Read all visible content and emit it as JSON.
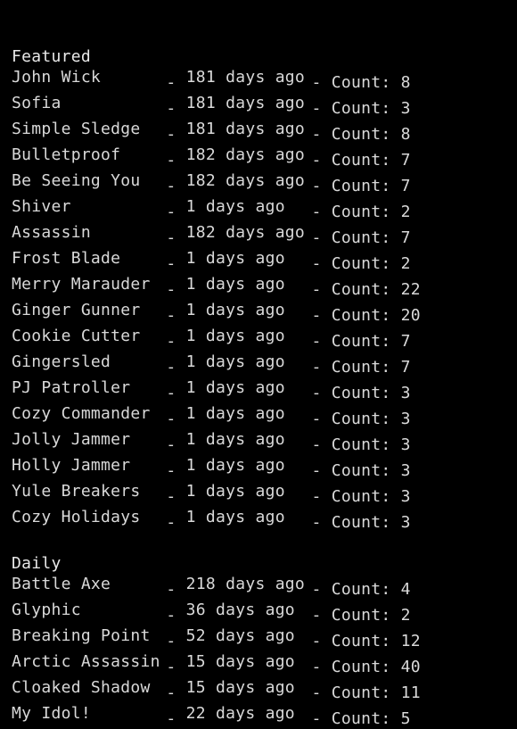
{
  "theme": {
    "background_color": "#000000",
    "text_color": "#d4d4d4",
    "heading_color": "#e8e8e8"
  },
  "labels": {
    "separator": "-",
    "count_label": "Count:",
    "age_unit": "days ago"
  },
  "sections": [
    {
      "title": "Featured",
      "rows": [
        {
          "name": "John Wick",
          "sep1": "-",
          "age": "181 days ago",
          "sep2": "-",
          "count_label": "Count:",
          "count": "8"
        },
        {
          "name": "Sofia",
          "sep1": "-",
          "age": "181 days ago",
          "sep2": "-",
          "count_label": "Count:",
          "count": "3"
        },
        {
          "name": "Simple Sledge",
          "sep1": "-",
          "age": "181 days ago",
          "sep2": "-",
          "count_label": "Count:",
          "count": "8"
        },
        {
          "name": "Bulletproof",
          "sep1": "-",
          "age": "182 days ago",
          "sep2": "-",
          "count_label": "Count:",
          "count": "7"
        },
        {
          "name": "Be Seeing You",
          "sep1": "-",
          "age": "182 days ago",
          "sep2": "-",
          "count_label": "Count:",
          "count": "7"
        },
        {
          "name": "Shiver",
          "sep1": "-",
          "age": "1 days ago",
          "sep2": "-",
          "count_label": "Count:",
          "count": "2"
        },
        {
          "name": "Assassin",
          "sep1": "-",
          "age": "182 days ago",
          "sep2": "-",
          "count_label": "Count:",
          "count": "7"
        },
        {
          "name": "Frost Blade",
          "sep1": "-",
          "age": "1 days ago",
          "sep2": "-",
          "count_label": "Count:",
          "count": "2"
        },
        {
          "name": "Merry Marauder",
          "sep1": "-",
          "age": "1 days ago",
          "sep2": "-",
          "count_label": "Count:",
          "count": "22"
        },
        {
          "name": "Ginger Gunner",
          "sep1": "-",
          "age": "1 days ago",
          "sep2": "-",
          "count_label": "Count:",
          "count": "20"
        },
        {
          "name": "Cookie Cutter",
          "sep1": "-",
          "age": "1 days ago",
          "sep2": "-",
          "count_label": "Count:",
          "count": "7"
        },
        {
          "name": "Gingersled",
          "sep1": "-",
          "age": "1 days ago",
          "sep2": "-",
          "count_label": "Count:",
          "count": "7"
        },
        {
          "name": "PJ Patroller",
          "sep1": "-",
          "age": "1 days ago",
          "sep2": "-",
          "count_label": "Count:",
          "count": "3"
        },
        {
          "name": "Cozy Commander",
          "sep1": "-",
          "age": "1 days ago",
          "sep2": "-",
          "count_label": "Count:",
          "count": "3"
        },
        {
          "name": "Jolly Jammer",
          "sep1": "-",
          "age": "1 days ago",
          "sep2": "-",
          "count_label": "Count:",
          "count": "3"
        },
        {
          "name": "Holly Jammer",
          "sep1": "-",
          "age": "1 days ago",
          "sep2": "-",
          "count_label": "Count:",
          "count": "3"
        },
        {
          "name": "Yule Breakers",
          "sep1": "-",
          "age": "1 days ago",
          "sep2": "-",
          "count_label": "Count:",
          "count": "3"
        },
        {
          "name": "Cozy Holidays",
          "sep1": "-",
          "age": "1 days ago",
          "sep2": "-",
          "count_label": "Count:",
          "count": "3"
        }
      ]
    },
    {
      "title": "Daily",
      "rows": [
        {
          "name": "Battle Axe",
          "sep1": "-",
          "age": "218 days ago",
          "sep2": "-",
          "count_label": "Count:",
          "count": "4"
        },
        {
          "name": "Glyphic",
          "sep1": "-",
          "age": "36 days ago",
          "sep2": "-",
          "count_label": "Count:",
          "count": "2"
        },
        {
          "name": "Breaking Point",
          "sep1": "-",
          "age": "52 days ago",
          "sep2": "-",
          "count_label": "Count:",
          "count": "12"
        },
        {
          "name": "Arctic Assassin",
          "sep1": "-",
          "age": "15 days ago",
          "sep2": "-",
          "count_label": "Count:",
          "count": "40"
        },
        {
          "name": "Cloaked Shadow",
          "sep1": "-",
          "age": "15 days ago",
          "sep2": "-",
          "count_label": "Count:",
          "count": "11"
        },
        {
          "name": "My Idol!",
          "sep1": "-",
          "age": "22 days ago",
          "sep2": "-",
          "count_label": "Count:",
          "count": "5"
        }
      ]
    }
  ]
}
